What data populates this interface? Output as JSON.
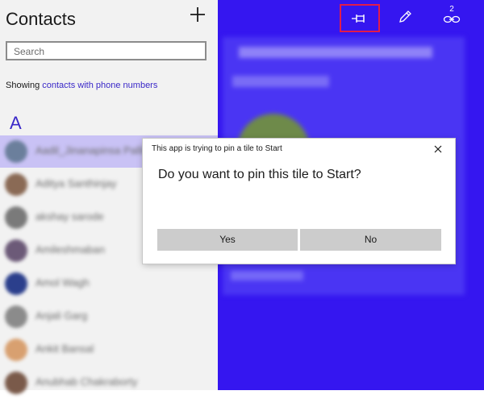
{
  "sidebar": {
    "title": "Contacts",
    "add_icon": "plus-icon",
    "search_placeholder": "Search",
    "showing_prefix": "Showing ",
    "showing_link": "contacts with phone numbers",
    "group_letter": "A",
    "contacts": [
      {
        "name": "Aadil_Jinanapinsa Pallikunnel",
        "avatar_color": "#6b7f9c",
        "selected": true
      },
      {
        "name": "Aditya Santhinjay",
        "avatar_color": "#8a6a55",
        "selected": false
      },
      {
        "name": "akshay sarode",
        "avatar_color": "#7a7a7a",
        "selected": false
      },
      {
        "name": "Amileshmaban",
        "avatar_color": "#6c5a78",
        "selected": false
      },
      {
        "name": "Amol Wagh",
        "avatar_color": "#2b3f8c",
        "selected": false
      },
      {
        "name": "Anjali Garg",
        "avatar_color": "#8b8b8b",
        "selected": false
      },
      {
        "name": "Ankit Bansal",
        "avatar_color": "#d8a070",
        "selected": false
      },
      {
        "name": "Anubhab Chakraborty",
        "avatar_color": "#7a5a4a",
        "selected": false
      }
    ]
  },
  "toolbar": {
    "pin_icon": "pin-icon",
    "edit_icon": "pencil-icon",
    "link_icon": "link-icon",
    "link_count": "2"
  },
  "dialog": {
    "title": "This app is trying to pin a tile to Start",
    "question": "Do you want to pin this tile to Start?",
    "yes_label": "Yes",
    "no_label": "No",
    "close_icon": "close-icon"
  },
  "colors": {
    "accent": "#3516f0",
    "link": "#3a28c8",
    "highlight": "#e21c4a"
  }
}
